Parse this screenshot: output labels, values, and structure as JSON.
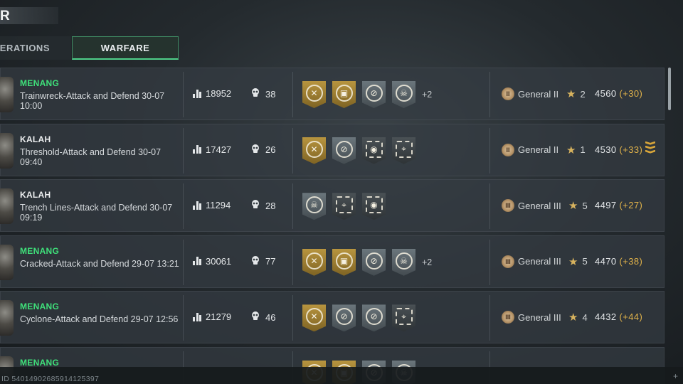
{
  "header": {
    "title": "R"
  },
  "tabs": [
    {
      "label": "PERATIONS",
      "active": false
    },
    {
      "label": "WARFARE",
      "active": true
    }
  ],
  "matches": [
    {
      "result": "MENANG",
      "win": true,
      "mode": "Trainwreck-Attack and Defend 30-07 10:00",
      "score": "18952",
      "kills": "38",
      "badges": [
        "gold",
        "gold",
        "silver",
        "silver"
      ],
      "more": "+2",
      "rank": "General II",
      "rank_numeral": "II",
      "stars": "2",
      "sr": "4560",
      "delta": "(+30)",
      "promo": false
    },
    {
      "result": "KALAH",
      "win": false,
      "mode": "Threshold-Attack and Defend 30-07 09:40",
      "score": "17427",
      "kills": "26",
      "badges": [
        "gold",
        "silver",
        "dark",
        "dark"
      ],
      "more": "",
      "rank": "General II",
      "rank_numeral": "II",
      "stars": "1",
      "sr": "4530",
      "delta": "(+33)",
      "promo": true
    },
    {
      "result": "KALAH",
      "win": false,
      "mode": "Trench Lines-Attack and Defend 30-07 09:19",
      "score": "11294",
      "kills": "28",
      "badges": [
        "silver",
        "dark",
        "dark"
      ],
      "more": "",
      "rank": "General III",
      "rank_numeral": "III",
      "stars": "5",
      "sr": "4497",
      "delta": "(+27)",
      "promo": false
    },
    {
      "result": "MENANG",
      "win": true,
      "mode": "Cracked-Attack and Defend 29-07 13:21",
      "score": "30061",
      "kills": "77",
      "badges": [
        "gold",
        "gold",
        "silver",
        "silver"
      ],
      "more": "+2",
      "rank": "General III",
      "rank_numeral": "III",
      "stars": "5",
      "sr": "4470",
      "delta": "(+38)",
      "promo": false
    },
    {
      "result": "MENANG",
      "win": true,
      "mode": "Cyclone-Attack and Defend 29-07 12:56",
      "score": "21279",
      "kills": "46",
      "badges": [
        "gold",
        "silver",
        "silver",
        "dark"
      ],
      "more": "",
      "rank": "General III",
      "rank_numeral": "III",
      "stars": "4",
      "sr": "4432",
      "delta": "(+44)",
      "promo": false
    },
    {
      "result": "MENANG",
      "win": true,
      "mode": "",
      "score": "",
      "kills": "",
      "badges": [
        "gold",
        "gold",
        "silver",
        "silver"
      ],
      "more": "",
      "rank": "",
      "rank_numeral": "",
      "stars": "",
      "sr": "",
      "delta": "",
      "promo": false
    }
  ],
  "footer": {
    "player_id": "ID 540149026859141253​97"
  },
  "colors": {
    "win": "#3fe07a",
    "accent": "#4fd18a",
    "delta": "#e0b24a",
    "gold_badge": "#b8953f"
  }
}
